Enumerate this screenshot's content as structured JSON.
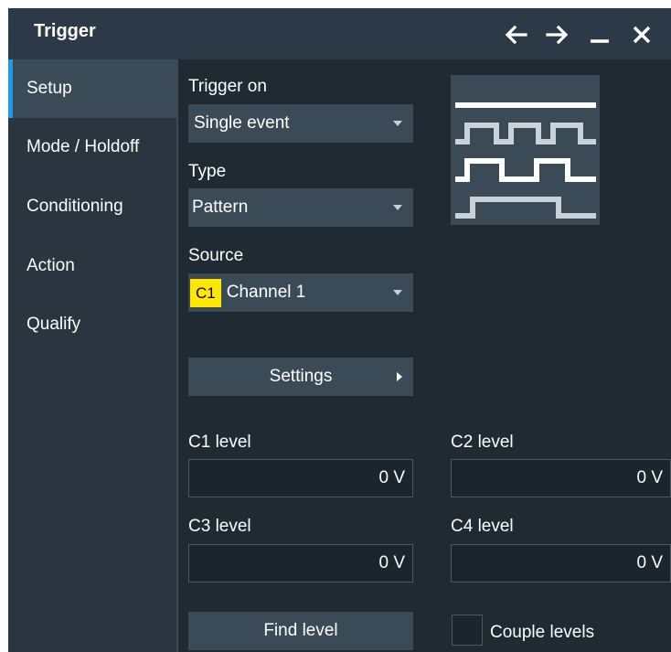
{
  "window": {
    "title": "Trigger"
  },
  "titlebar_icons": [
    "arrow-left-icon",
    "arrow-right-icon",
    "minimize-icon",
    "close-icon"
  ],
  "sidebar": {
    "items": [
      {
        "label": "Setup",
        "active": true
      },
      {
        "label": "Mode / Holdoff",
        "active": false
      },
      {
        "label": "Conditioning",
        "active": false
      },
      {
        "label": "Action",
        "active": false
      },
      {
        "label": "Qualify",
        "active": false
      }
    ]
  },
  "setup": {
    "trigger_on": {
      "label": "Trigger on",
      "value": "Single event"
    },
    "type": {
      "label": "Type",
      "value": "Pattern"
    },
    "source": {
      "label": "Source",
      "badge": "C1",
      "value": "Channel 1"
    },
    "settings_button": "Settings",
    "levels": [
      {
        "label": "C1 level",
        "value": "0 V"
      },
      {
        "label": "C2 level",
        "value": "0 V"
      },
      {
        "label": "C3 level",
        "value": "0 V"
      },
      {
        "label": "C4 level",
        "value": "0 V"
      }
    ],
    "find_level_button": "Find level",
    "couple_levels": {
      "label": "Couple levels",
      "checked": false
    }
  },
  "colors": {
    "accent": "#1e9be5",
    "badge": "#ffe800",
    "background": "#1f2a33",
    "panel": "#3b4a57"
  }
}
